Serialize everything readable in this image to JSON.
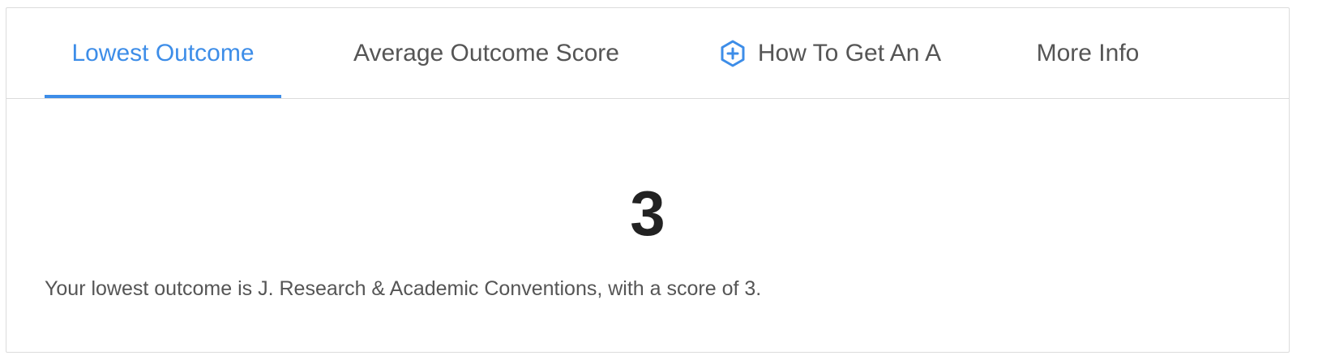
{
  "tabs": [
    {
      "label": "Lowest Outcome",
      "active": true
    },
    {
      "label": "Average Outcome Score",
      "active": false
    },
    {
      "label": "How To Get An A",
      "active": false,
      "icon": "plus-hexagon-icon"
    },
    {
      "label": "More Info",
      "active": false
    }
  ],
  "content": {
    "score": "3",
    "summary": "Your lowest outcome is J. Research & Academic Conventions, with a score of 3."
  },
  "colors": {
    "accent": "#3d8de8",
    "text": "#555555",
    "score": "#222222",
    "border": "#dcdcdc"
  }
}
